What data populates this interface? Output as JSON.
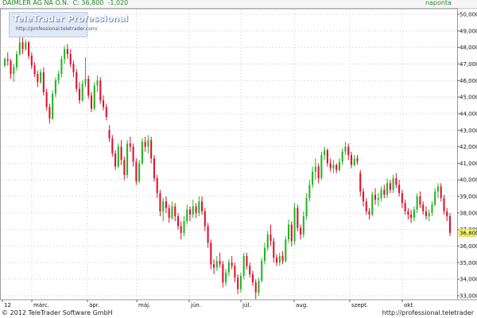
{
  "header": {
    "symbol_text": "DAIMLER AG NA O.N.  C: 36,800  -1,020",
    "period": "naponta"
  },
  "logo": {
    "title": "TeleTrader Professional",
    "url": "http://professional.teletrader.com/"
  },
  "footer": {
    "copyright": "© 2012 TeleTrader Software GmbH",
    "url": "http://professional.teletrader"
  },
  "colors": {
    "up": "#22b522",
    "down": "#e0102e",
    "grid": "#c9c9c9",
    "price_marker_bg": "#ffff66"
  },
  "chart_data": {
    "type": "candlestick",
    "ylim": [
      33.0,
      50.0
    ],
    "y_ticks": [
      "33,000",
      "34,000",
      "35,000",
      "36,000",
      "37,000",
      "38,000",
      "39,000",
      "40,000",
      "41,000",
      "42,000",
      "43,000",
      "44,000",
      "45,000",
      "46,000",
      "47,000",
      "48,000",
      "49,000",
      "50,000"
    ],
    "x_labels": [
      "12",
      "márc.",
      "ápr.",
      "máj.",
      "jún.",
      "júl.",
      "aug.",
      "szept.",
      "okt."
    ],
    "last_price_label": "36,800",
    "last_price": 36.8,
    "grid": true,
    "candles": [
      [
        46.9,
        47.4,
        46.8,
        47.3
      ],
      [
        47.3,
        47.7,
        46.9,
        47.2
      ],
      [
        47.2,
        47.3,
        46.1,
        46.4
      ],
      [
        46.4,
        47.0,
        45.9,
        46.8
      ],
      [
        46.8,
        47.8,
        46.6,
        47.6
      ],
      [
        47.6,
        48.7,
        47.5,
        48.3
      ],
      [
        48.3,
        48.6,
        47.6,
        47.9
      ],
      [
        47.9,
        48.5,
        47.8,
        48.3
      ],
      [
        48.3,
        48.4,
        47.3,
        47.5
      ],
      [
        47.5,
        47.7,
        46.7,
        46.9
      ],
      [
        46.9,
        47.1,
        46.2,
        46.4
      ],
      [
        46.4,
        46.6,
        45.6,
        45.9
      ],
      [
        45.9,
        46.7,
        45.8,
        46.5
      ],
      [
        46.5,
        46.8,
        45.1,
        45.3
      ],
      [
        45.3,
        45.5,
        44.2,
        44.4
      ],
      [
        44.4,
        44.6,
        43.4,
        43.7
      ],
      [
        43.7,
        45.4,
        43.6,
        45.2
      ],
      [
        45.2,
        46.2,
        45.0,
        46.0
      ],
      [
        46.0,
        46.6,
        45.8,
        46.4
      ],
      [
        46.4,
        47.5,
        46.2,
        47.3
      ],
      [
        47.3,
        48.1,
        47.0,
        47.9
      ],
      [
        47.9,
        48.2,
        47.3,
        47.6
      ],
      [
        47.6,
        47.9,
        46.8,
        47.0
      ],
      [
        47.0,
        47.2,
        46.2,
        46.5
      ],
      [
        46.5,
        46.7,
        45.3,
        45.5
      ],
      [
        45.5,
        45.9,
        44.6,
        44.8
      ],
      [
        44.8,
        46.0,
        44.7,
        45.8
      ],
      [
        45.8,
        47.4,
        45.6,
        46.1
      ],
      [
        46.1,
        46.3,
        44.9,
        45.1
      ],
      [
        45.1,
        45.3,
        44.1,
        44.3
      ],
      [
        44.3,
        45.9,
        44.2,
        45.7
      ],
      [
        45.7,
        46.3,
        45.3,
        46.0
      ],
      [
        46.0,
        46.2,
        44.6,
        44.8
      ],
      [
        44.8,
        45.1,
        44.2,
        44.4
      ],
      [
        44.4,
        44.6,
        43.6,
        43.8
      ],
      [
        43.0,
        43.3,
        42.3,
        42.5
      ],
      [
        42.5,
        42.7,
        41.4,
        41.6
      ],
      [
        41.6,
        41.8,
        40.6,
        40.8
      ],
      [
        40.8,
        42.2,
        40.7,
        42.0
      ],
      [
        42.0,
        42.4,
        40.9,
        41.2
      ],
      [
        41.2,
        41.4,
        40.0,
        40.3
      ],
      [
        40.3,
        42.4,
        40.1,
        42.2
      ],
      [
        42.2,
        42.6,
        41.7,
        42.0
      ],
      [
        42.0,
        42.2,
        40.8,
        41.1
      ],
      [
        41.1,
        41.3,
        39.7,
        39.9
      ],
      [
        39.9,
        41.2,
        39.8,
        41.0
      ],
      [
        41.0,
        42.5,
        40.9,
        42.3
      ],
      [
        42.3,
        42.6,
        41.7,
        42.0
      ],
      [
        42.0,
        42.7,
        41.6,
        42.4
      ],
      [
        42.4,
        42.6,
        41.0,
        41.3
      ],
      [
        41.3,
        41.5,
        39.9,
        40.1
      ],
      [
        40.1,
        40.3,
        38.9,
        39.2
      ],
      [
        39.2,
        39.4,
        37.8,
        38.1
      ],
      [
        38.1,
        38.9,
        37.5,
        38.7
      ],
      [
        38.7,
        39.0,
        38.0,
        38.3
      ],
      [
        38.3,
        38.5,
        37.4,
        37.7
      ],
      [
        37.7,
        38.7,
        37.6,
        38.4
      ],
      [
        38.4,
        38.6,
        37.5,
        37.8
      ],
      [
        37.8,
        38.0,
        37.0,
        37.2
      ],
      [
        37.2,
        37.5,
        36.4,
        36.8
      ],
      [
        36.8,
        37.8,
        36.6,
        37.5
      ],
      [
        37.5,
        38.5,
        37.3,
        38.2
      ],
      [
        38.2,
        38.4,
        37.5,
        37.9
      ],
      [
        37.9,
        38.8,
        37.7,
        38.4
      ],
      [
        38.4,
        38.6,
        37.7,
        38.0
      ],
      [
        38.0,
        39.0,
        37.8,
        38.7
      ],
      [
        38.7,
        39.0,
        37.9,
        38.1
      ],
      [
        38.1,
        38.3,
        36.9,
        37.2
      ],
      [
        37.2,
        37.4,
        35.9,
        36.2
      ],
      [
        36.2,
        36.4,
        34.6,
        34.9
      ],
      [
        34.9,
        35.2,
        34.3,
        34.7
      ],
      [
        34.7,
        35.4,
        34.5,
        35.1
      ],
      [
        35.1,
        35.6,
        34.7,
        34.9
      ],
      [
        34.9,
        35.1,
        33.5,
        33.8
      ],
      [
        33.8,
        34.6,
        33.6,
        34.4
      ],
      [
        34.4,
        35.2,
        34.2,
        35.0
      ],
      [
        35.0,
        35.4,
        34.6,
        34.8
      ],
      [
        34.8,
        35.0,
        33.8,
        34.1
      ],
      [
        34.1,
        34.3,
        33.1,
        33.4
      ],
      [
        33.4,
        34.4,
        33.2,
        34.2
      ],
      [
        34.2,
        35.6,
        34.0,
        35.4
      ],
      [
        35.4,
        35.6,
        34.6,
        34.8
      ],
      [
        34.8,
        35.0,
        34.1,
        34.3
      ],
      [
        34.3,
        34.5,
        33.6,
        33.8
      ],
      [
        33.8,
        34.0,
        32.8,
        33.2
      ],
      [
        33.2,
        34.1,
        33.0,
        33.9
      ],
      [
        33.9,
        35.3,
        33.8,
        35.1
      ],
      [
        35.1,
        36.2,
        34.9,
        35.9
      ],
      [
        35.9,
        36.9,
        35.7,
        36.7
      ],
      [
        36.7,
        37.3,
        36.0,
        36.3
      ],
      [
        36.3,
        36.5,
        35.0,
        35.3
      ],
      [
        35.3,
        35.5,
        34.8,
        35.0
      ],
      [
        35.0,
        35.6,
        34.8,
        35.4
      ],
      [
        35.4,
        35.7,
        34.9,
        35.1
      ],
      [
        35.1,
        36.6,
        35.0,
        36.4
      ],
      [
        36.4,
        37.6,
        36.2,
        37.3
      ],
      [
        37.3,
        37.5,
        36.0,
        36.3
      ],
      [
        36.3,
        38.6,
        36.1,
        38.3
      ],
      [
        38.3,
        38.5,
        36.9,
        37.1
      ],
      [
        37.1,
        37.3,
        36.4,
        36.7
      ],
      [
        36.7,
        38.1,
        36.5,
        37.8
      ],
      [
        37.8,
        39.2,
        37.6,
        38.9
      ],
      [
        38.9,
        40.0,
        38.7,
        39.7
      ],
      [
        39.7,
        40.8,
        39.5,
        40.5
      ],
      [
        40.5,
        41.3,
        40.0,
        40.8
      ],
      [
        40.8,
        41.0,
        39.8,
        40.1
      ],
      [
        40.1,
        41.7,
        40.0,
        41.5
      ],
      [
        41.5,
        42.0,
        41.2,
        41.8
      ],
      [
        41.8,
        41.9,
        40.8,
        41.0
      ],
      [
        41.0,
        41.3,
        40.5,
        40.7
      ],
      [
        40.7,
        41.2,
        40.4,
        40.9
      ],
      [
        40.9,
        41.0,
        40.4,
        40.6
      ],
      [
        40.6,
        41.3,
        40.5,
        41.1
      ],
      [
        41.1,
        41.9,
        40.9,
        41.7
      ],
      [
        41.7,
        42.3,
        41.5,
        42.0
      ],
      [
        42.0,
        42.2,
        41.2,
        41.5
      ],
      [
        41.5,
        41.7,
        40.7,
        40.9
      ],
      [
        40.9,
        41.5,
        40.8,
        41.3
      ],
      [
        41.3,
        41.5,
        40.9,
        41.1
      ],
      [
        40.4,
        40.6,
        39.0,
        39.3
      ],
      [
        39.3,
        39.5,
        38.4,
        38.7
      ],
      [
        38.7,
        38.9,
        37.9,
        38.1
      ],
      [
        38.1,
        38.3,
        37.6,
        37.9
      ],
      [
        37.9,
        39.3,
        37.8,
        39.1
      ],
      [
        39.1,
        39.5,
        38.5,
        38.8
      ],
      [
        38.8,
        39.2,
        38.4,
        38.9
      ],
      [
        38.9,
        39.6,
        38.7,
        39.4
      ],
      [
        39.4,
        39.7,
        38.9,
        39.1
      ],
      [
        39.1,
        40.1,
        38.9,
        39.8
      ],
      [
        39.8,
        40.0,
        39.2,
        39.4
      ],
      [
        39.4,
        40.3,
        39.2,
        40.1
      ],
      [
        40.1,
        40.4,
        39.5,
        39.7
      ],
      [
        39.7,
        40.0,
        39.0,
        39.2
      ],
      [
        39.2,
        39.4,
        38.3,
        38.6
      ],
      [
        38.6,
        38.8,
        37.9,
        38.1
      ],
      [
        38.1,
        38.3,
        37.6,
        37.9
      ],
      [
        37.9,
        38.2,
        37.4,
        37.7
      ],
      [
        37.7,
        38.4,
        37.5,
        38.2
      ],
      [
        38.2,
        39.2,
        38.0,
        39.0
      ],
      [
        39.0,
        39.3,
        38.3,
        38.5
      ],
      [
        38.5,
        38.7,
        37.9,
        38.1
      ],
      [
        38.1,
        38.4,
        37.6,
        37.8
      ],
      [
        37.8,
        38.2,
        37.5,
        38.0
      ],
      [
        38.0,
        38.7,
        37.8,
        38.5
      ],
      [
        38.5,
        39.5,
        38.4,
        39.3
      ],
      [
        39.3,
        39.8,
        38.9,
        39.6
      ],
      [
        39.6,
        39.8,
        38.7,
        38.9
      ],
      [
        38.9,
        39.1,
        37.9,
        38.1
      ],
      [
        38.1,
        38.3,
        37.5,
        37.8
      ],
      [
        37.8,
        38.0,
        36.6,
        36.8
      ]
    ]
  }
}
